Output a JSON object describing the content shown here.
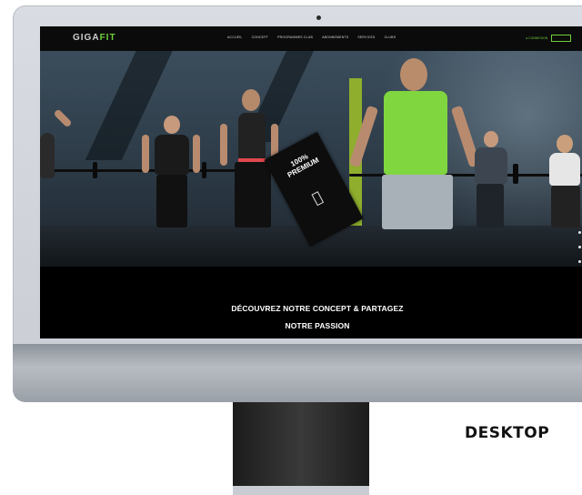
{
  "site": {
    "logo_main": "GIGA",
    "logo_accent": "FIT",
    "menu": [
      {
        "label": "ACCUEIL"
      },
      {
        "label": "CONCEPT"
      },
      {
        "label": "PROGRAMMES CLUB"
      },
      {
        "label": "ABONNEMENTS"
      },
      {
        "label": "SERVICES"
      },
      {
        "label": "CLUBS"
      }
    ],
    "login_label": "● CONNEXION",
    "hero_badge": "100% PREMIUM",
    "tagline_line1": "DÉCOUVREZ NOTRE CONCEPT & PARTAGEZ",
    "tagline_line2": "NOTRE PASSION"
  },
  "caption": "DESKTOP",
  "colors": {
    "brand_green": "#6fcf3a",
    "shirt_green": "#7fd63f",
    "site_background": "#000000",
    "monitor_bezel": "#d3d7dc"
  }
}
